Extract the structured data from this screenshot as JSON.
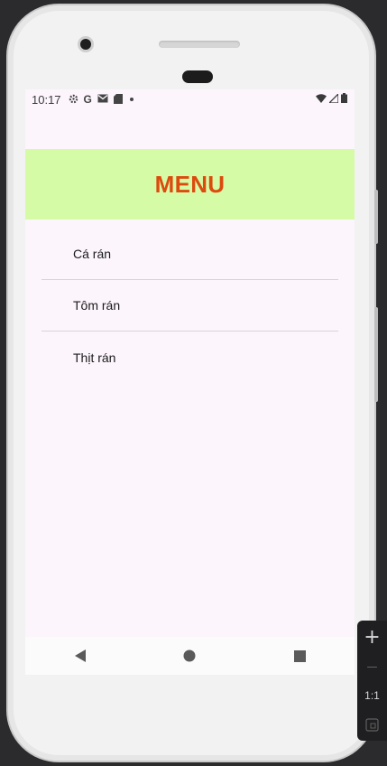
{
  "status_bar": {
    "time": "10:17",
    "left_icons": [
      "gear-icon",
      "google-icon",
      "gmail-icon",
      "sd-card-icon",
      "dot-icon"
    ],
    "right_icons": [
      "wifi-icon",
      "signal-icon",
      "battery-icon"
    ]
  },
  "header": {
    "title": "MENU",
    "background": "#d6fba6",
    "title_color": "#dc4a0e"
  },
  "menu": {
    "items": [
      {
        "label": "Cá rán"
      },
      {
        "label": "Tôm rán"
      },
      {
        "label": "Thịt rán"
      }
    ]
  },
  "nav_bar": {
    "buttons": [
      "back-icon",
      "home-icon",
      "recents-icon"
    ]
  },
  "emulator_toolbar": {
    "zoom_in": "+",
    "zoom_out": "—",
    "actual_size": "1:1",
    "fit_icon": "fit-screen-icon"
  }
}
